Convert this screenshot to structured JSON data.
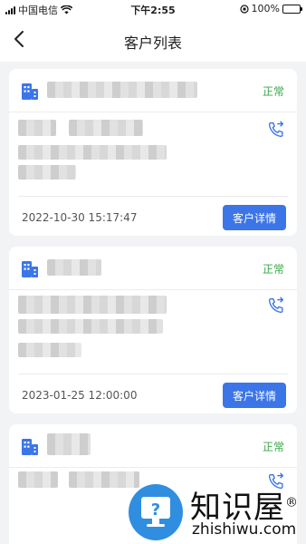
{
  "status_bar": {
    "carrier": "中国电信",
    "time": "下午2:55",
    "battery_percent": "100%"
  },
  "nav": {
    "title": "客户列表"
  },
  "customers": [
    {
      "status": "正常",
      "datetime": "2022-10-30 15:17:47",
      "detail_button": "客户详情"
    },
    {
      "status": "正常",
      "datetime": "2023-01-25 12:00:00",
      "detail_button": "客户详情"
    },
    {
      "status": "正常"
    }
  ],
  "watermark": {
    "title": "知识屋",
    "registered": "®",
    "domain": "zhishiwu.com",
    "logo_symbol": "?"
  },
  "colors": {
    "accent": "#3b75e8",
    "status_green": "#3aa84a"
  }
}
